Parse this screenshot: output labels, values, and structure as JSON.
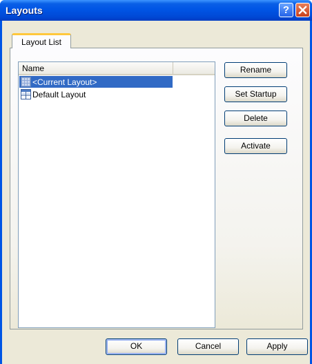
{
  "window": {
    "title": "Layouts",
    "help_label": "?",
    "colors": {
      "titlebar": "#0055e5",
      "client": "#ece9d8",
      "selection": "#316ac5"
    }
  },
  "tabs": [
    {
      "label": "Layout List",
      "active": true
    }
  ],
  "layout_list": {
    "columns": [
      {
        "label": "Name"
      }
    ],
    "items": [
      {
        "label": "<Current Layout>",
        "icon": "current-layout-icon",
        "selected": true
      },
      {
        "label": "Default Layout",
        "icon": "layout-grid-icon",
        "selected": false
      }
    ]
  },
  "side_buttons": {
    "rename": "Rename",
    "set_startup": "Set Startup",
    "delete": "Delete",
    "activate": "Activate"
  },
  "dialog_buttons": {
    "ok": "OK",
    "cancel": "Cancel",
    "apply": "Apply"
  }
}
